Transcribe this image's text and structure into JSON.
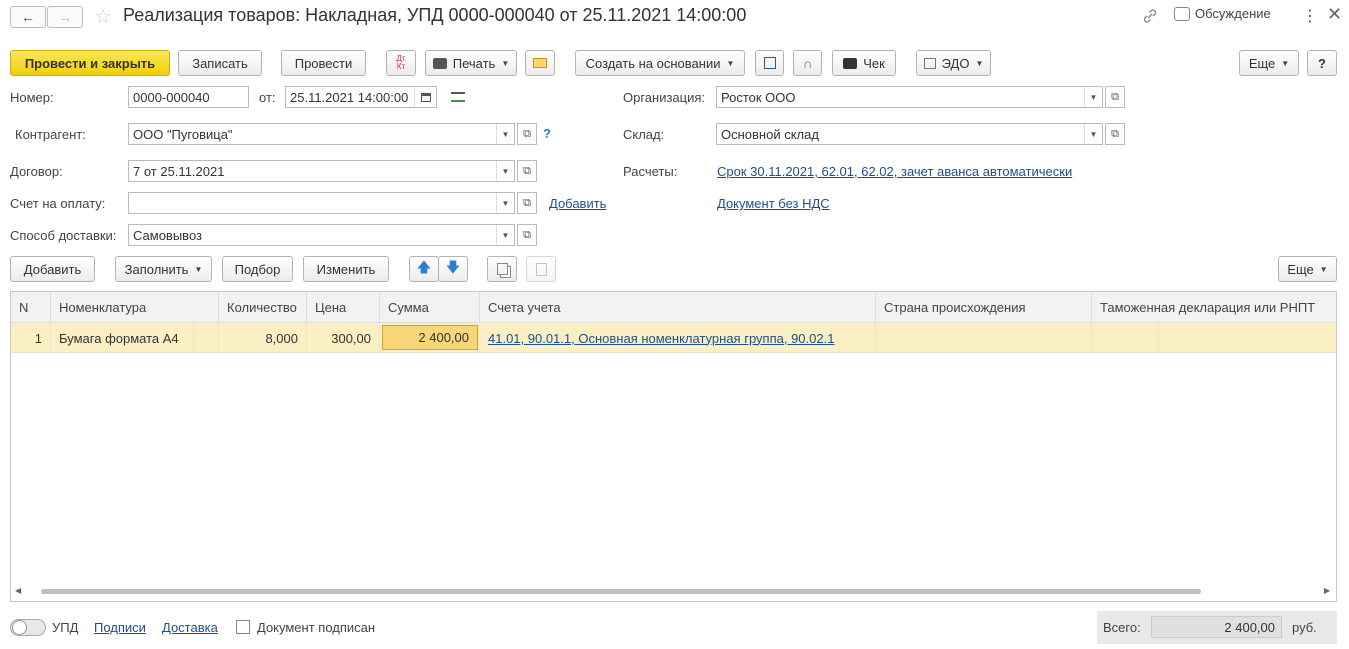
{
  "window": {
    "title": "Реализация товаров: Накладная, УПД 0000-000040 от 25.11.2021 14:00:00",
    "discussion_label": "Обсуждение"
  },
  "toolbar": {
    "post_close_label": "Провести и закрыть",
    "save_label": "Записать",
    "post_label": "Провести",
    "dt_kt_label": "Дт Кт",
    "print_label": "Печать",
    "create_based_label": "Создать на основании",
    "check_label": "Чек",
    "edo_label": "ЭДО",
    "more_label": "Еще",
    "help_label": "?"
  },
  "form": {
    "number_label": "Номер:",
    "number_value": "0000-000040",
    "from_label": "от:",
    "date_value": "25.11.2021 14:00:00",
    "org_label": "Организация:",
    "org_value": "Росток ООО",
    "contractor_label": "Контрагент:",
    "contractor_value": "ООО \"Пуговица\"",
    "help_mark": "?",
    "warehouse_label": "Склад:",
    "warehouse_value": "Основной склад",
    "contract_label": "Договор:",
    "contract_value": "7 от 25.11.2021",
    "settlements_label": "Расчеты:",
    "settlements_link": "Срок 30.11.2021, 62.01, 62.02, зачет аванса автоматически",
    "invoice_label": "Счет на оплату:",
    "invoice_value": "",
    "add_link": "Добавить",
    "vat_link": "Документ без НДС",
    "delivery_label": "Способ доставки:",
    "delivery_value": "Самовывоз"
  },
  "table_toolbar": {
    "add_label": "Добавить",
    "fill_label": "Заполнить",
    "select_label": "Подбор",
    "change_label": "Изменить",
    "more_label": "Еще"
  },
  "table": {
    "headers": [
      "N",
      "Номенклатура",
      "Количество",
      "Цена",
      "Сумма",
      "Счета учета",
      "Страна происхождения",
      "Таможенная декларация или РНПТ"
    ],
    "rows": [
      {
        "n": "1",
        "item": "Бумага формата А4",
        "qty": "8,000",
        "price": "300,00",
        "sum": "2 400,00",
        "accounts": "41.01, 90.01.1, Основная номенклатурная группа, 90.02.1",
        "country": "",
        "customs": ""
      }
    ]
  },
  "footer": {
    "upd_label": "УПД",
    "signatures_link": "Подписи",
    "delivery_link": "Доставка",
    "signed_label": "Документ подписан",
    "total_label": "Всего:",
    "total_value": "2 400,00",
    "currency": "руб."
  }
}
